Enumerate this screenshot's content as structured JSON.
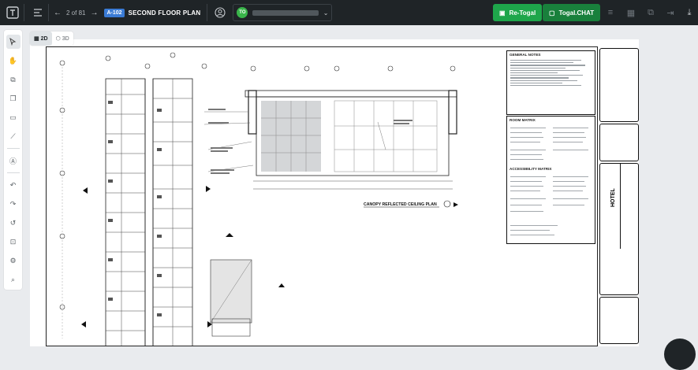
{
  "toolbar": {
    "pager_text": "2 of 81",
    "sheet_number": "A-102",
    "sheet_title": "SECOND FLOOR PLAN",
    "user_initials": "TO",
    "retogal_label": "Re-Togal",
    "chat_label": "Togal.CHAT"
  },
  "view": {
    "label_2d": "2D",
    "label_3d": "3D",
    "active": "2D"
  },
  "drawing": {
    "general_notes_title": "GENERAL NOTES",
    "room_matrix_title": "ROOM MATRIX",
    "accessibility_title": "ACCESSIBILITY MATRIX",
    "canopy_title": "CANOPY REFLECTED CEILING PLAN",
    "hotel_label": "HOTEL"
  },
  "colors": {
    "topbar": "#1f2427",
    "green": "#1ea64b",
    "green_dark": "#19803c",
    "badge_blue": "#3a7bd5"
  },
  "icons": {
    "left_tools": [
      "cursor-icon",
      "hand-icon",
      "copy-icon",
      "layers-icon",
      "area-icon",
      "ruler-icon",
      "compass-icon",
      "undo-icon",
      "redo-icon",
      "history-icon",
      "focus-icon",
      "sliders-icon",
      "search-icon"
    ],
    "right_tools": [
      "list-icon",
      "grid-icon",
      "stack-icon",
      "collapse-icon",
      "download-icon"
    ]
  }
}
